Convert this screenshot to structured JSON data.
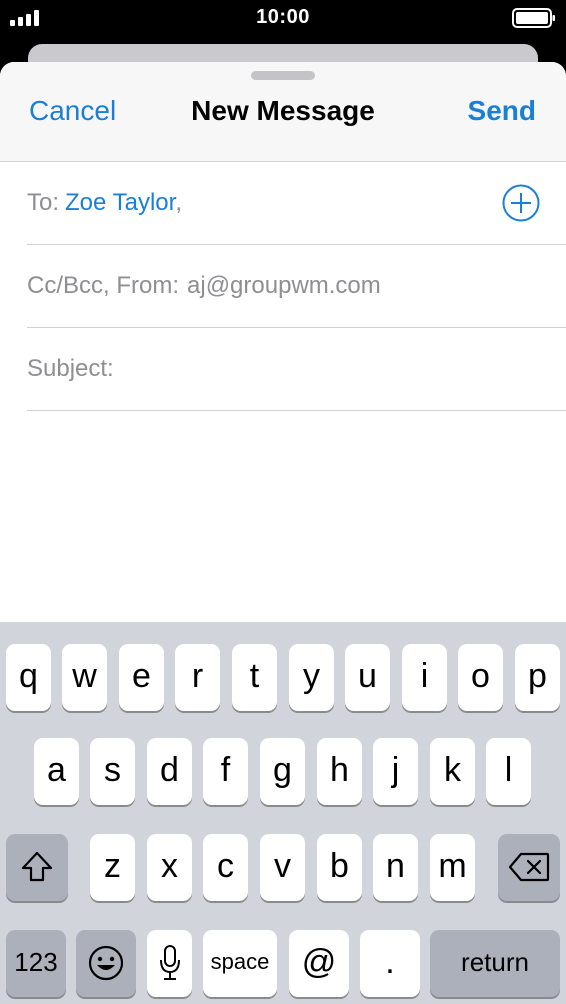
{
  "status_bar": {
    "time": "10:00"
  },
  "compose": {
    "cancel_label": "Cancel",
    "title": "New Message",
    "send_label": "Send",
    "to_label": "To:",
    "recipient": "Zoe Taylor",
    "recipient_separator": ",",
    "cc_label": "Cc/Bcc, From:",
    "from_address": "aj@groupwm.com",
    "subject_label": "Subject:",
    "subject_value": ""
  },
  "keyboard": {
    "row1": [
      "q",
      "w",
      "e",
      "r",
      "t",
      "y",
      "u",
      "i",
      "o",
      "p"
    ],
    "row2": [
      "a",
      "s",
      "d",
      "f",
      "g",
      "h",
      "j",
      "k",
      "l"
    ],
    "row3": [
      "z",
      "x",
      "c",
      "v",
      "b",
      "n",
      "m"
    ],
    "numbers_label": "123",
    "space_label": "space",
    "at_label": "@",
    "period_label": ".",
    "return_label": "return"
  },
  "colors": {
    "accent": "#1a7fd6",
    "keyboard_bg": "#d1d5db",
    "key_dark": "#abb0ba"
  },
  "icons": {
    "signal": "signal-bars-icon",
    "battery": "battery-icon",
    "add_contact": "plus-circle-icon",
    "shift": "shift-arrow-icon",
    "delete": "backspace-icon",
    "emoji": "emoji-face-icon",
    "dictation": "microphone-icon"
  }
}
